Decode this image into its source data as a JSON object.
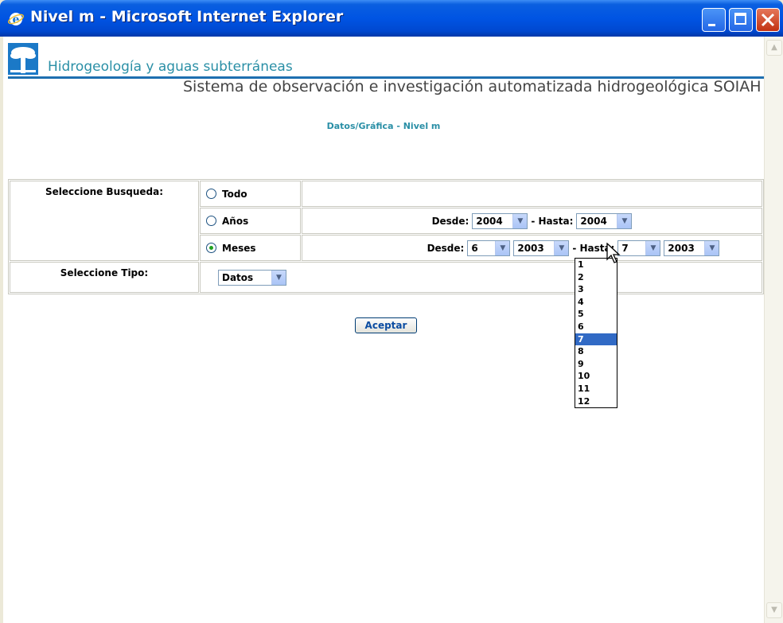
{
  "window": {
    "title": "Nivel m - Microsoft Internet Explorer"
  },
  "header": {
    "site_title": "Hidrogeología y aguas subterráneas",
    "system_name": "Sistema de observación e investigación automatizada hidrogeológica SOIAH",
    "page_heading": "Datos/Gráfica - Nivel m"
  },
  "form": {
    "search_label": "Seleccione Busqueda:",
    "type_label": "Seleccione Tipo:",
    "options": {
      "todo": "Todo",
      "anos": "Años",
      "meses": "Meses"
    },
    "selected_option": "Meses",
    "anos": {
      "desde_label": "Desde:",
      "desde_year": "2004",
      "hasta_label": "- Hasta:",
      "hasta_year": "2004"
    },
    "meses": {
      "desde_label": "Desde:",
      "desde_month": "6",
      "desde_year": "2003",
      "hasta_label": "- Hasta:",
      "hasta_month": "7",
      "hasta_year": "2003"
    },
    "tipo": "Datos",
    "accept_label": "Aceptar"
  },
  "dropdown": {
    "items": [
      "1",
      "2",
      "3",
      "4",
      "5",
      "6",
      "7",
      "8",
      "9",
      "10",
      "11",
      "12"
    ],
    "selected": "7"
  },
  "icons": {
    "window": "ie-icon",
    "logo": "palm-tree-logo-icon",
    "arrow": "chevron-down-icon"
  },
  "colors": {
    "titlebar": "#0054e3",
    "accent": "#2a8fa6",
    "selection": "#316ac5"
  }
}
